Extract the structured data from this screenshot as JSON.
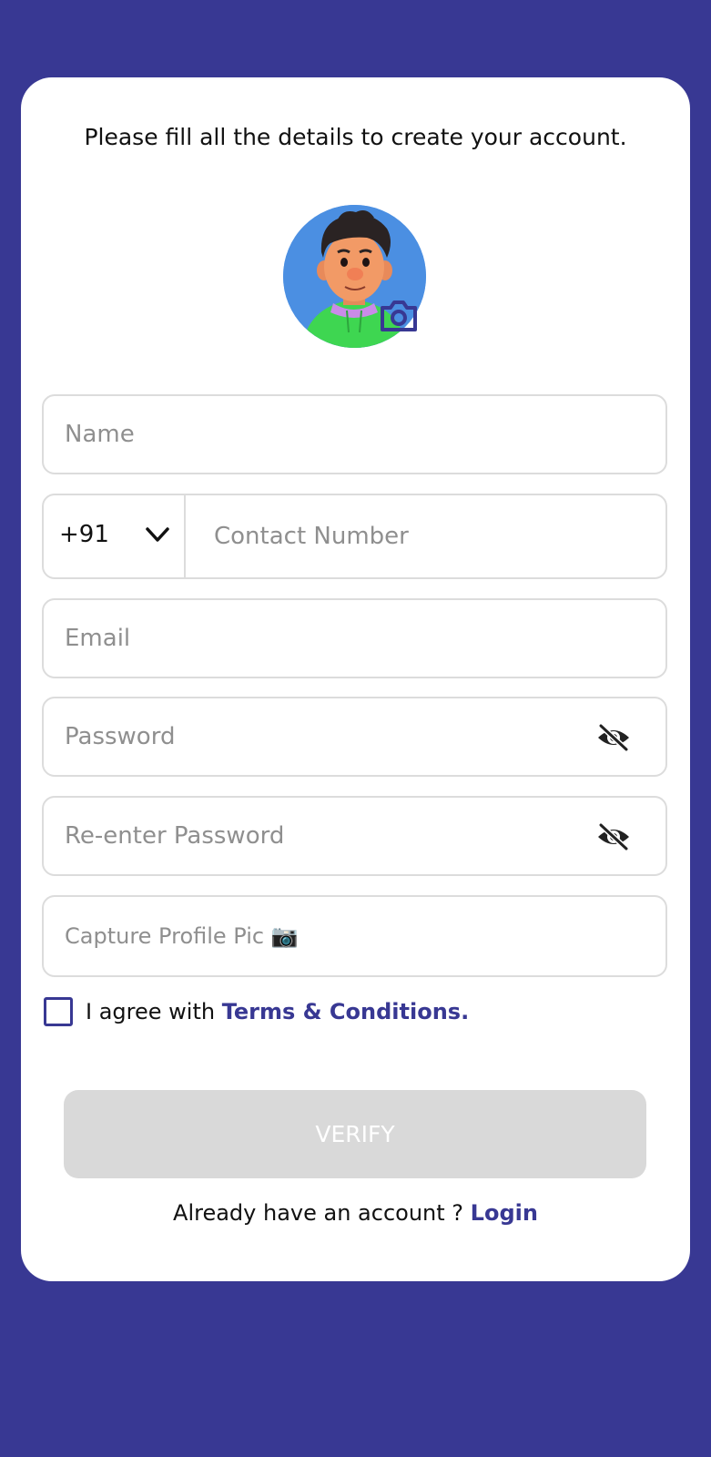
{
  "form": {
    "intro_text": "Please fill all the details to create your account.",
    "avatar_icon": "user-avatar",
    "camera_icon": "camera-icon",
    "name_placeholder": "Name",
    "country_code": "+91",
    "contact_placeholder": "Contact Number",
    "email_placeholder": "Email",
    "password_placeholder": "Password",
    "reenter_password_placeholder": "Re-enter Password",
    "capture_pic_placeholder": "Capture Profile Pic 📷",
    "agree_prefix": "I agree with ",
    "terms_link": "Terms & Conditions.",
    "verify_label": "VERIFY",
    "login_prompt": "Already have an account ? ",
    "login_link": "Login"
  },
  "colors": {
    "background": "#383893",
    "card": "#ffffff",
    "accent": "#383893",
    "button_disabled": "#d9d9d9"
  }
}
